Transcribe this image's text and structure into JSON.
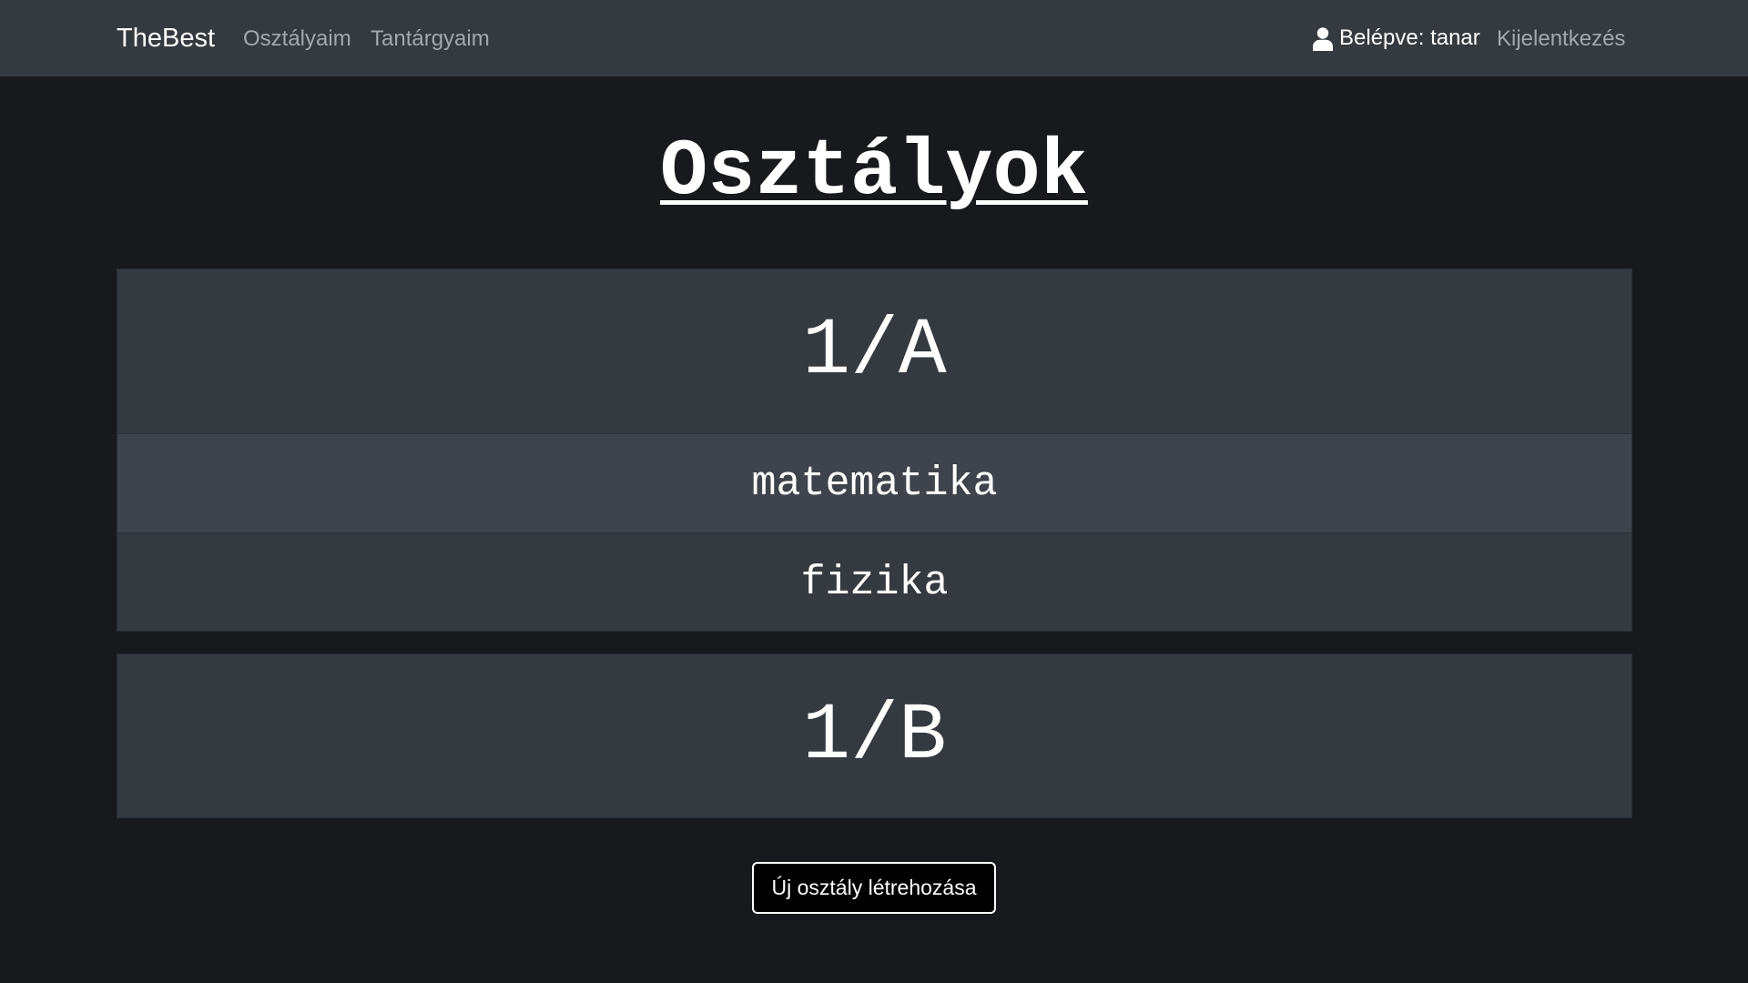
{
  "navbar": {
    "brand": "TheBest",
    "links": [
      "Osztályaim",
      "Tantárgyaim"
    ],
    "user": {
      "icon": "user-icon",
      "label": "Belépve: tanar"
    },
    "logout": "Kijelentkezés"
  },
  "main": {
    "title": "Osztályok",
    "classes": [
      {
        "name": "1/A",
        "subjects": [
          "matematika",
          "fizika"
        ]
      },
      {
        "name": "1/B",
        "subjects": []
      }
    ],
    "new_class_button": "Új osztály létrehozása"
  },
  "colors": {
    "page_background": "#17191d",
    "navbar_background": "#353940",
    "card_background": "#353940",
    "row_alt_background": "#3f444c",
    "muted_link": "#a4a8ae",
    "text": "#ffffff"
  }
}
